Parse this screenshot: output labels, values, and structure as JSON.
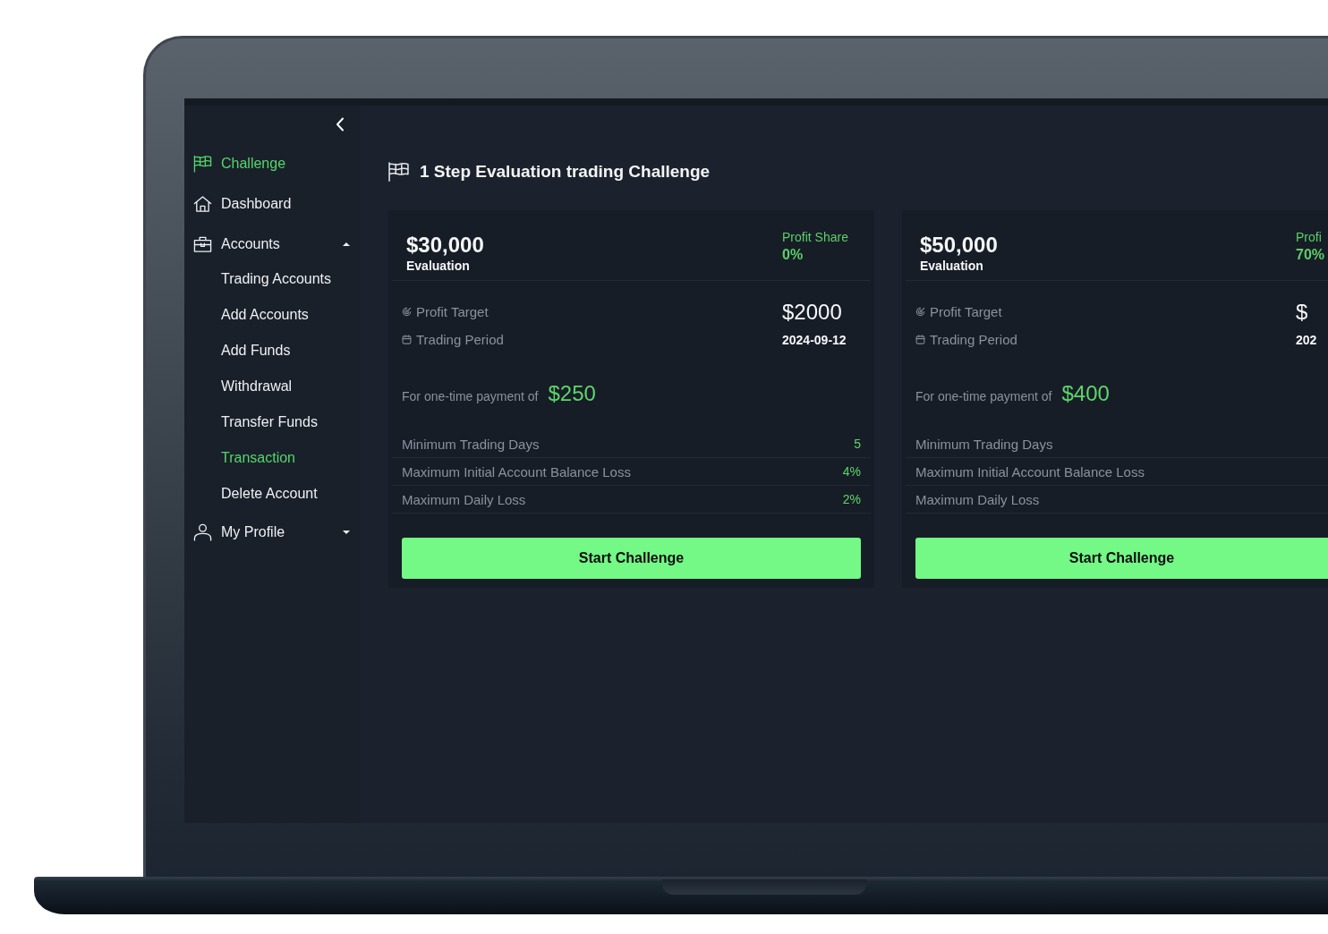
{
  "sidebar": {
    "items": [
      {
        "label": "Challenge",
        "kind": "link",
        "selected": true
      },
      {
        "label": "Dashboard",
        "kind": "link",
        "selected": false
      },
      {
        "label": "Accounts",
        "kind": "group",
        "selected": false,
        "expanded": true,
        "children": [
          {
            "label": "Trading Accounts",
            "selected": false
          },
          {
            "label": "Add Accounts",
            "selected": false
          },
          {
            "label": "Add Funds",
            "selected": false
          },
          {
            "label": "Withdrawal",
            "selected": false
          },
          {
            "label": "Transfer Funds",
            "selected": false
          },
          {
            "label": "Transaction",
            "selected": true
          },
          {
            "label": "Delete Account",
            "selected": false
          }
        ]
      },
      {
        "label": "My Profile",
        "kind": "group",
        "selected": false,
        "expanded": false
      }
    ]
  },
  "page": {
    "title": "1 Step Evaluation trading Challenge"
  },
  "cards": [
    {
      "size": "$30,000",
      "size_label": "Evaluation",
      "profit_share_label": "Profit Share",
      "profit_share": "0%",
      "details": [
        {
          "kind": "amount",
          "label": "Profit Target",
          "value": "$2000"
        },
        {
          "kind": "date",
          "label": "Trading Period",
          "value": "2024-09-12"
        }
      ],
      "payment_label": "For one-time payment of",
      "payment": "$250",
      "rules": [
        {
          "label": "Minimum Trading Days",
          "value": "5"
        },
        {
          "label": "Maximum Initial Account Balance Loss",
          "value": "4%"
        },
        {
          "label": "Maximum Daily Loss",
          "value": "2%"
        }
      ],
      "button": "Start Challenge"
    },
    {
      "size": "$50,000",
      "size_label": "Evaluation",
      "profit_share_label": "Profi",
      "profit_share": "70%",
      "details": [
        {
          "kind": "amount",
          "label": "Profit Target",
          "value": "$"
        },
        {
          "kind": "date",
          "label": "Trading Period",
          "value": "202"
        }
      ],
      "payment_label": "For one-time payment of",
      "payment": "$400",
      "rules": [
        {
          "label": "Minimum Trading Days"
        },
        {
          "label": "Maximum Initial Account Balance Loss"
        },
        {
          "label": "Maximum Daily Loss"
        }
      ],
      "button": "Start Challenge"
    }
  ]
}
